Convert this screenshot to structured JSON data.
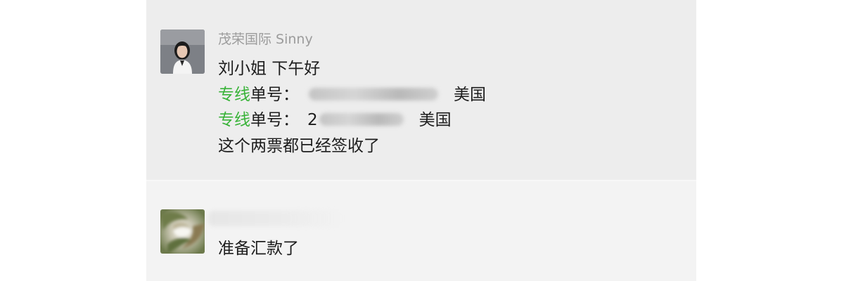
{
  "messages": [
    {
      "sender": "茂荣国际 Sinny",
      "lines": [
        {
          "text": "刘小姐   下午好"
        },
        {
          "tag": "专线",
          "label": "单号：",
          "prefix": "",
          "suffix": "美国"
        },
        {
          "tag": "专线",
          "label": "单号：",
          "prefix": "2",
          "suffix": "美国"
        },
        {
          "text": "这个两票都已经签收了"
        }
      ]
    },
    {
      "sender": "",
      "lines": [
        {
          "text": "准备汇款了"
        }
      ]
    }
  ],
  "colors": {
    "tag_green": "#39b339",
    "message_bg": "#ededed",
    "panel_bg": "#f3f3f3"
  }
}
